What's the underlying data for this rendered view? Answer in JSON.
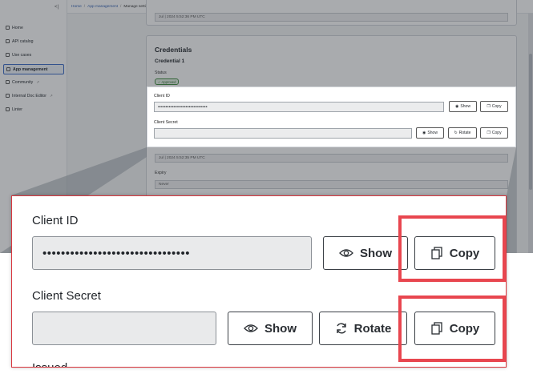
{
  "sidebar": {
    "collapse_icon": "<|",
    "items": [
      {
        "label": "Home",
        "icon": "home-icon"
      },
      {
        "label": "API catalog",
        "icon": "api-icon"
      },
      {
        "label": "Use cases",
        "icon": "usecases-icon"
      },
      {
        "label": "App management",
        "icon": "app-icon",
        "active": true
      },
      {
        "label": "Community",
        "icon": "community-icon",
        "external": true
      },
      {
        "label": "Internal Doc Editor",
        "icon": "doc-icon",
        "external": true
      },
      {
        "label": "Linter",
        "icon": "linter-icon"
      }
    ]
  },
  "breadcrumb": {
    "home": "Home",
    "section": "App management",
    "current": "Manage settings",
    "separator": "/"
  },
  "top_card": {
    "timestamp": "Jul | 2024 5:52:36 PM UTC"
  },
  "credentials": {
    "title": "Credentials",
    "subtitle": "Credential 1",
    "status_label": "Status",
    "status_badge": "Approved",
    "issued_label": "Issued",
    "issued_value": "Jul | 2024 5:52:35 PM UTC",
    "expiry_label": "Expiry",
    "expiry_value": "Never"
  },
  "client_id": {
    "label": "Client ID",
    "masked_value": "••••••••••••••••••••••••••••••••",
    "show_label": "Show",
    "copy_label": "Copy"
  },
  "client_secret": {
    "label": "Client Secret",
    "value": "",
    "show_label": "Show",
    "rotate_label": "Rotate",
    "copy_label": "Copy"
  },
  "colors": {
    "highlight": "#e8464f",
    "link": "#2f5fb3",
    "approved": "#3d8b3d"
  }
}
